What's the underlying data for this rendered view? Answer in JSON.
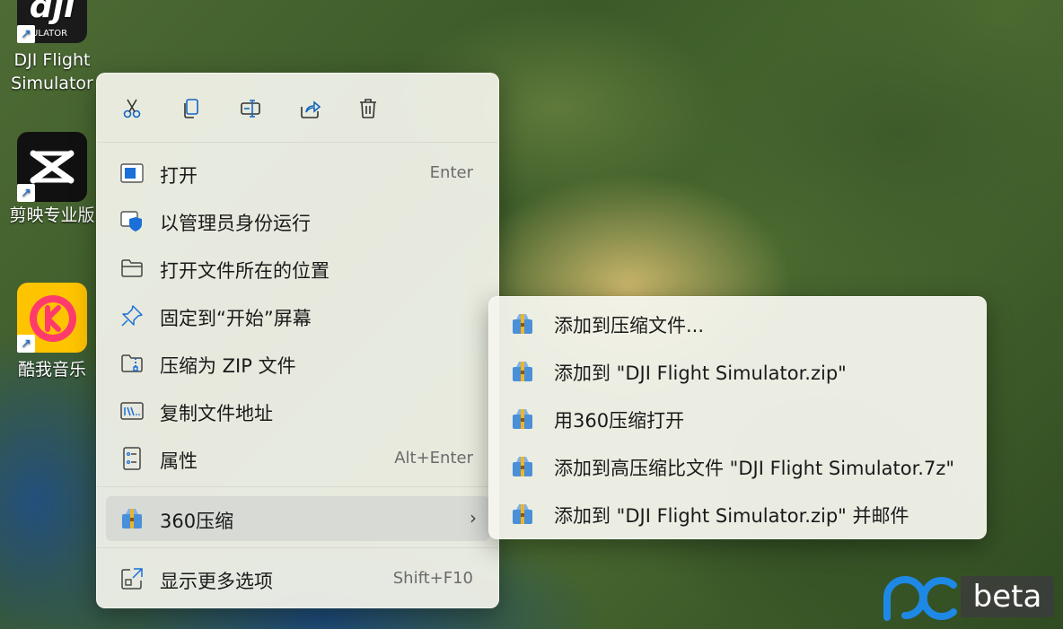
{
  "desktop": {
    "icons": [
      {
        "label": "DJI Flight Simulator",
        "tile_text": "ULATOR",
        "tile_color": "#1a1a1a",
        "icon": "dji-app-icon"
      },
      {
        "label": "剪映专业版",
        "tile_color": "#111111",
        "icon": "capcut-app-icon"
      },
      {
        "label": "酷我音乐",
        "tile_color": "#ffc400",
        "icon": "kuwo-music-app-icon"
      }
    ]
  },
  "context_menu": {
    "toolbar": [
      {
        "name": "cut-icon"
      },
      {
        "name": "copy-icon"
      },
      {
        "name": "rename-icon"
      },
      {
        "name": "share-icon"
      },
      {
        "name": "delete-icon"
      }
    ],
    "items": [
      {
        "label": "打开",
        "shortcut": "Enter",
        "icon": "open-app-icon"
      },
      {
        "label": "以管理员身份运行",
        "shortcut": "",
        "icon": "admin-shield-icon"
      },
      {
        "label": "打开文件所在的位置",
        "shortcut": "",
        "icon": "folder-icon"
      },
      {
        "label": "固定到“开始”屏幕",
        "shortcut": "",
        "icon": "pin-icon"
      },
      {
        "label": "压缩为 ZIP 文件",
        "shortcut": "",
        "icon": "zip-folder-icon"
      },
      {
        "label": "复制文件地址",
        "shortcut": "",
        "icon": "copy-path-icon"
      },
      {
        "label": "属性",
        "shortcut": "Alt+Enter",
        "icon": "properties-icon"
      },
      {
        "label": "360压缩",
        "shortcut": "",
        "icon": "360zip-icon",
        "chevron": "›"
      },
      {
        "label": "显示更多选项",
        "shortcut": "Shift+F10",
        "icon": "show-more-icon"
      }
    ]
  },
  "submenu": {
    "items": [
      {
        "label": "添加到压缩文件..."
      },
      {
        "label": "添加到 \"DJI Flight Simulator.zip\""
      },
      {
        "label": "用360压缩打开"
      },
      {
        "label": "添加到高压缩比文件 \"DJI Flight Simulator.7z\""
      },
      {
        "label": "添加到 \"DJI Flight Simulator.zip\" 并邮件"
      }
    ]
  },
  "watermark": {
    "text": "beta",
    "color": "#1e88e5"
  },
  "colors": {
    "accent": "#1a6fd8",
    "archive_blue": "#4a90d9",
    "archive_yellow": "#f0b429"
  }
}
